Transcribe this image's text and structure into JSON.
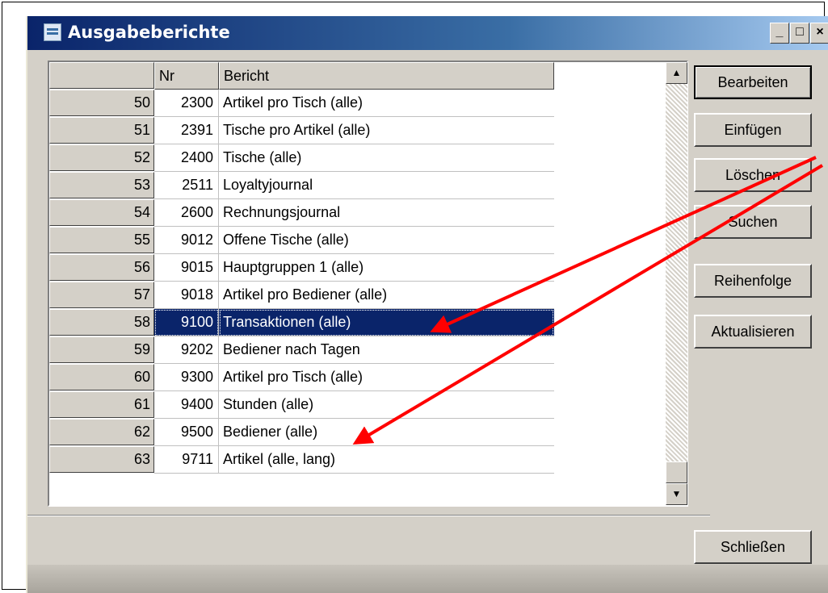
{
  "window": {
    "title": "Ausgabeberichte",
    "minimize": "_",
    "maximize": "□",
    "close": "×"
  },
  "grid": {
    "columns": {
      "rowhdr": "",
      "nr": "Nr",
      "bericht": "Bericht"
    },
    "selected_row": 58,
    "rows": [
      {
        "row": "50",
        "nr": "2300",
        "bericht": "Artikel pro Tisch (alle)"
      },
      {
        "row": "51",
        "nr": "2391",
        "bericht": "Tische pro Artikel (alle)"
      },
      {
        "row": "52",
        "nr": "2400",
        "bericht": "Tische (alle)"
      },
      {
        "row": "53",
        "nr": "2511",
        "bericht": "Loyaltyjournal"
      },
      {
        "row": "54",
        "nr": "2600",
        "bericht": "Rechnungsjournal"
      },
      {
        "row": "55",
        "nr": "9012",
        "bericht": "Offene Tische (alle)"
      },
      {
        "row": "56",
        "nr": "9015",
        "bericht": "Hauptgruppen 1 (alle)"
      },
      {
        "row": "57",
        "nr": "9018",
        "bericht": "Artikel pro Bediener (alle)"
      },
      {
        "row": "58",
        "nr": "9100",
        "bericht": "Transaktionen (alle)"
      },
      {
        "row": "59",
        "nr": "9202",
        "bericht": "Bediener nach Tagen"
      },
      {
        "row": "60",
        "nr": "9300",
        "bericht": "Artikel pro Tisch (alle)"
      },
      {
        "row": "61",
        "nr": "9400",
        "bericht": "Stunden (alle)"
      },
      {
        "row": "62",
        "nr": "9500",
        "bericht": "Bediener (alle)"
      },
      {
        "row": "63",
        "nr": "9711",
        "bericht": "Artikel (alle, lang)"
      }
    ]
  },
  "buttons": {
    "bearbeiten": "Bearbeiten",
    "einfuegen": "Einfügen",
    "loeschen": "Löschen",
    "suchen": "Suchen",
    "reihenfolge": "Reihenfolge",
    "aktualisieren": "Aktualisieren",
    "schliessen": "Schließen"
  },
  "annotation_color": "#ff0000"
}
